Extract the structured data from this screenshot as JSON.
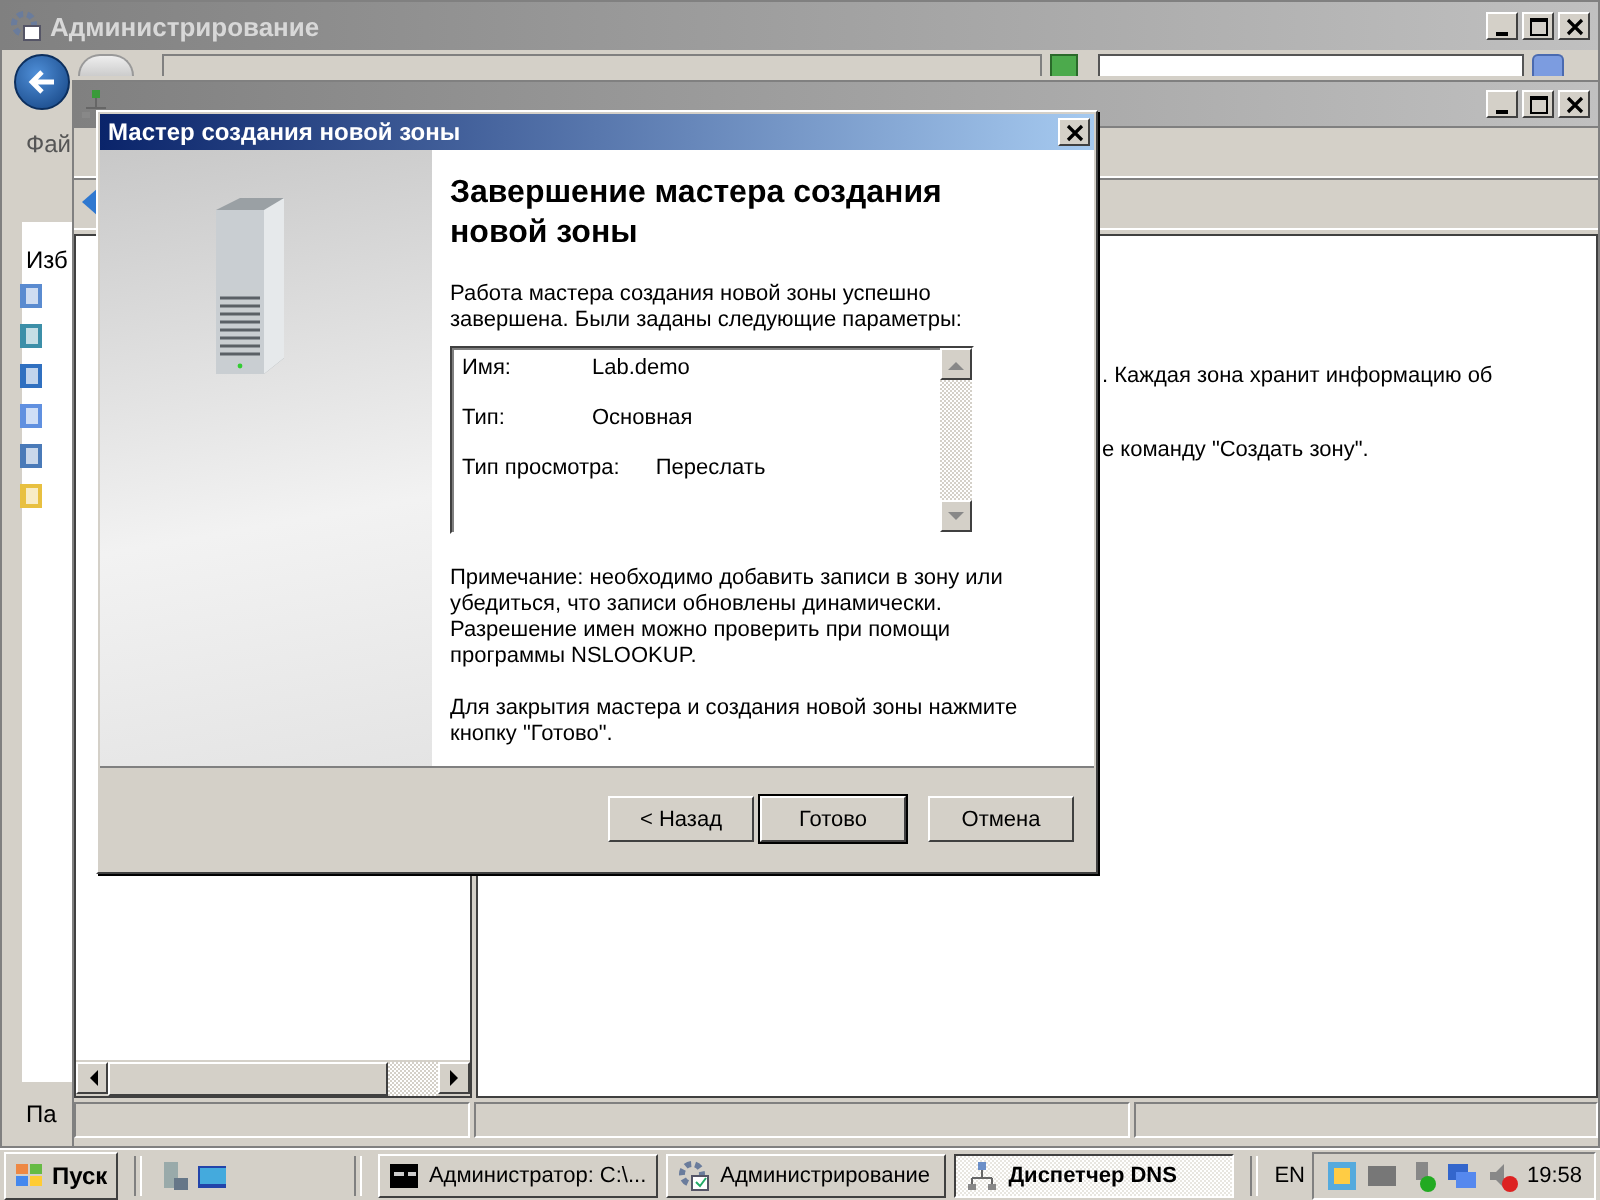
{
  "admin_window": {
    "title": "Администрирование",
    "menu_label": "Фай",
    "nav_label": "Изб",
    "bottom_label": "Па"
  },
  "dns_window": {
    "details": [
      ". Каждая зона хранит информацию об",
      "е команду \"Создать зону\"."
    ]
  },
  "dialog": {
    "title": "Мастер создания новой зоны",
    "heading": "Завершение мастера создания новой зоны",
    "intro": "Работа мастера создания новой зоны успешно завершена. Были заданы следующие параметры:",
    "summary": [
      {
        "label": "Имя:",
        "value": "Lab.demo"
      },
      {
        "label": "Тип:",
        "value": "Основная"
      },
      {
        "label": "Тип просмотра:",
        "value": "Переслать"
      }
    ],
    "note": "Примечание: необходимо добавить записи в зону или убедиться, что записи обновлены динамически. Разрешение имен можно проверить при помощи программы NSLOOKUP.",
    "closing": "Для закрытия мастера и создания новой зоны нажмите кнопку \"Готово\".",
    "buttons": [
      {
        "label": "< Назад",
        "default": false
      },
      {
        "label": "Готово",
        "default": true
      },
      {
        "label": "Отмена",
        "default": false
      }
    ]
  },
  "taskbar": {
    "start": "Пуск",
    "tasks": [
      {
        "label": "Администратор: C:\\...",
        "kind": "console",
        "selected": false
      },
      {
        "label": "Администрирование",
        "kind": "admin",
        "selected": false
      },
      {
        "label": "Диспетчер DNS",
        "kind": "dns",
        "selected": true
      }
    ],
    "language": "EN",
    "clock": "19:58"
  }
}
